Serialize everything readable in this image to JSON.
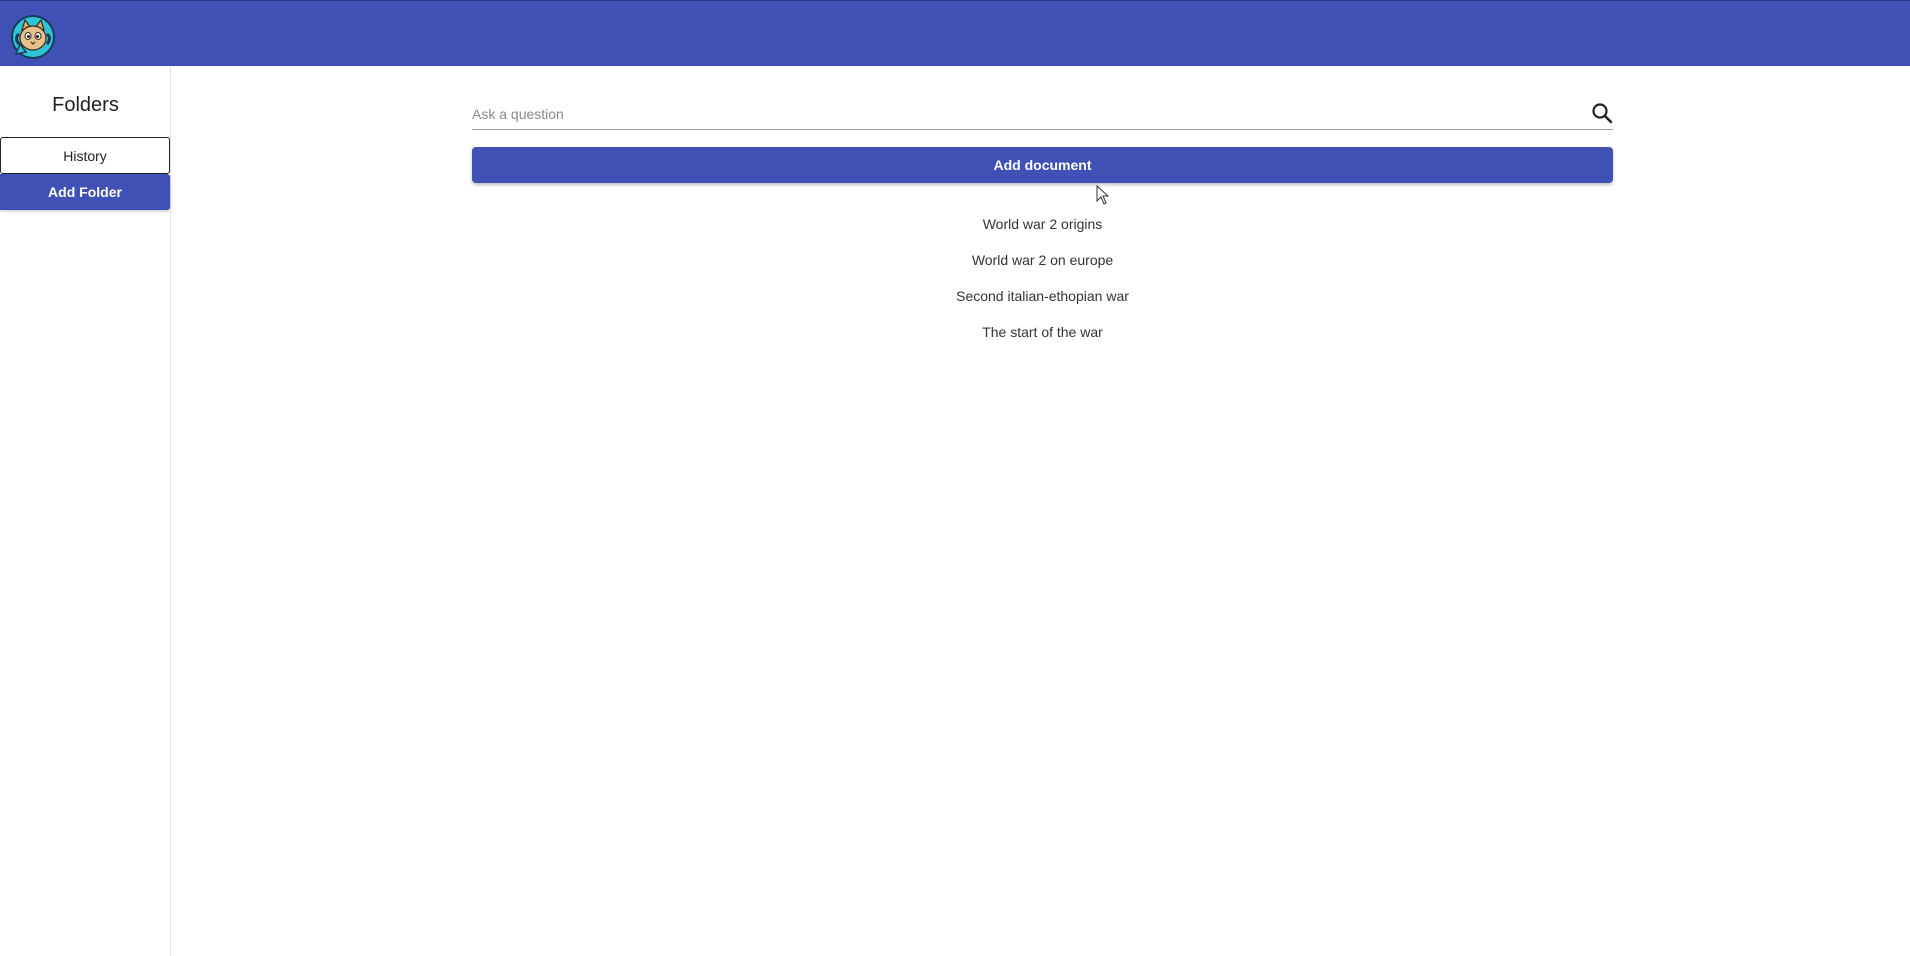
{
  "header": {
    "logo_icon": "cat-avatar-logo-icon",
    "background_color": "#3f51b5"
  },
  "sidebar": {
    "title": "Folders",
    "folders": [
      {
        "label": "History"
      }
    ],
    "add_folder_label": "Add Folder"
  },
  "main": {
    "search": {
      "placeholder": "Ask a question",
      "value": "",
      "icon": "search-icon"
    },
    "add_document_label": "Add document",
    "documents": [
      {
        "title": "World war 2 origins"
      },
      {
        "title": "World war 2 on europe"
      },
      {
        "title": "Second italian-ethopian war"
      },
      {
        "title": "The start of the war"
      }
    ]
  },
  "colors": {
    "accent": "#3f51b5",
    "text": "#222222"
  }
}
